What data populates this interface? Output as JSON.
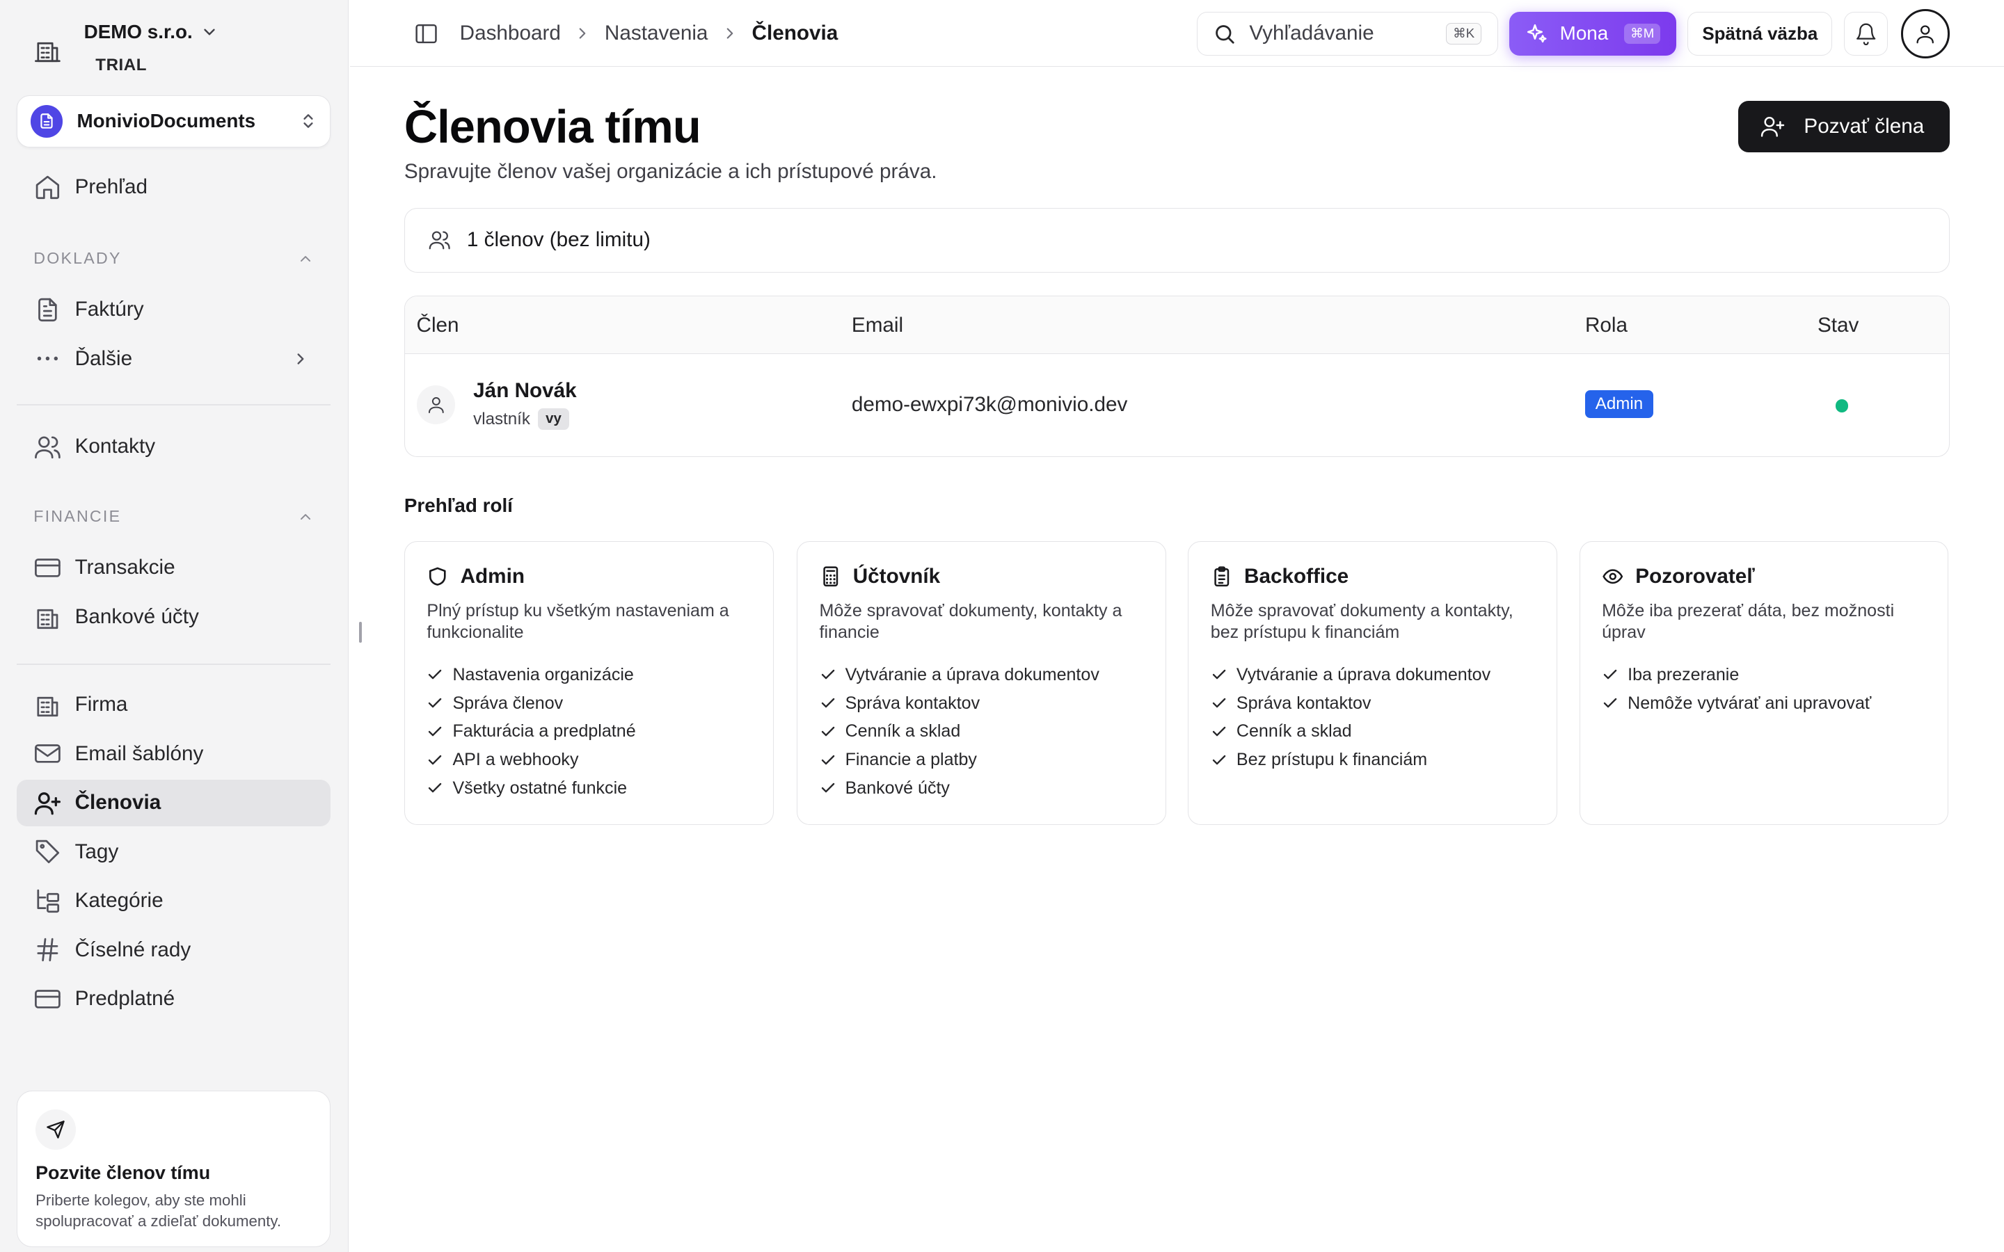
{
  "org": {
    "name": "DEMO s.r.o.",
    "plan": "TRIAL"
  },
  "app": {
    "name": "MonivioDocuments"
  },
  "sidebar": {
    "overview": "Prehľad",
    "section_documents": "DOKLADY",
    "invoices": "Faktúry",
    "more": "Ďalšie",
    "contacts": "Kontakty",
    "section_finance": "FINANCIE",
    "transactions": "Transakcie",
    "bank_accounts": "Bankové účty",
    "company": "Firma",
    "email_templates": "Email šablóny",
    "members": "Členovia",
    "tags": "Tagy",
    "categories": "Kategórie",
    "number_series": "Číselné rady",
    "subscription": "Predplatné",
    "active_item": "members"
  },
  "invite_card": {
    "title": "Pozvite členov tímu",
    "text": "Priberte kolegov, aby ste mohli spolupracovať a zdieľať dokumenty."
  },
  "topbar": {
    "breadcrumbs": [
      "Dashboard",
      "Nastavenia",
      "Členovia"
    ],
    "search_placeholder": "Vyhľadávanie",
    "search_shortcut": "⌘K",
    "mona_label": "Mona",
    "mona_shortcut": "⌘M",
    "feedback_label": "Spätná väzba"
  },
  "main": {
    "title": "Členovia tímu",
    "subtitle": "Spravujte členov vašej organizácie a ich prístupové práva.",
    "invite_button": "Pozvať člena",
    "member_count": "1 členov (bez limitu)",
    "table": {
      "headers": [
        "Člen",
        "Email",
        "Rola",
        "Stav"
      ],
      "rows": [
        {
          "name": "Ján Novák",
          "role_label": "vlastník",
          "you_tag": "vy",
          "email": "demo-ewxpi73k@monivio.dev",
          "role": "Admin",
          "status": "active",
          "status_color": "#10b981"
        }
      ]
    },
    "roles_title": "Prehľad rolí",
    "roles": [
      {
        "name": "Admin",
        "icon": "shield-icon",
        "description": "Plný prístup ku všetkým nastaveniam a funkcionalite",
        "permissions": [
          "Nastavenia organizácie",
          "Správa členov",
          "Fakturácia a predplatné",
          "API a webhooky",
          "Všetky ostatné funkcie"
        ]
      },
      {
        "name": "Účtovník",
        "icon": "calculator-icon",
        "description": "Môže spravovať dokumenty, kontakty a financie",
        "permissions": [
          "Vytváranie a úprava dokumentov",
          "Správa kontaktov",
          "Cenník a sklad",
          "Financie a platby",
          "Bankové účty"
        ]
      },
      {
        "name": "Backoffice",
        "icon": "clipboard-icon",
        "description": "Môže spravovať dokumenty a kontakty, bez prístupu k financiám",
        "permissions": [
          "Vytváranie a úprava dokumentov",
          "Správa kontaktov",
          "Cenník a sklad",
          "Bez prístupu k financiám"
        ]
      },
      {
        "name": "Pozorovateľ",
        "icon": "eye-icon",
        "description": "Môže iba prezerať dáta, bez možnosti úprav",
        "permissions": [
          "Iba prezeranie",
          "Nemôže vytvárať ani upravovať"
        ]
      }
    ]
  },
  "colors": {
    "accent": "#7c3aed",
    "primary_button": "#18181b",
    "admin_badge": "#2563eb",
    "status_active": "#10b981"
  }
}
